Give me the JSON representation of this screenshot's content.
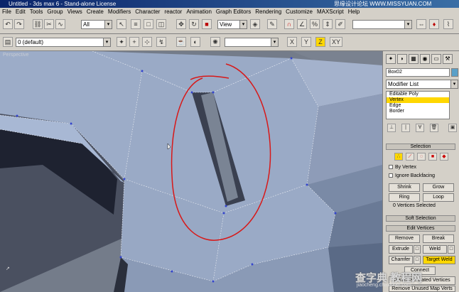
{
  "window": {
    "title": "Untitled - 3ds max 6 - Stand-alone License",
    "watermark_top": "思缘设计论坛  WWW.MISSYUAN.COM"
  },
  "menu": [
    "File",
    "Edit",
    "Tools",
    "Group",
    "Views",
    "Create",
    "Modifiers",
    "Character",
    "reactor",
    "Animation",
    "Graph Editors",
    "Rendering",
    "Customize",
    "MAXScript",
    "Help"
  ],
  "toolbar": {
    "selection_filter": "All",
    "reference_coord": "View",
    "named_selection": ""
  },
  "toolbar2": {
    "layer": "0 (default)",
    "axis_x": "X",
    "axis_y": "Y",
    "axis_z": "Z",
    "axis_xy": "XY"
  },
  "viewport": {
    "label": "Perspective"
  },
  "command_panel": {
    "object_name": "Box02",
    "modifier_list": "Modifier List",
    "stack": [
      "Editable Poly",
      "Vertex",
      "Edge",
      "Border"
    ],
    "stack_selected_index": 1,
    "selection_title": "Selection",
    "by_vertex": "By Vertex",
    "ignore_backfacing": "Ignore Backfacing",
    "shrink": "Shrink",
    "grow": "Grow",
    "ring": "Ring",
    "loop": "Loop",
    "vertices_selected": "0 Vertices Selected",
    "soft_selection": "Soft Selection",
    "edit_vertices": "Edit Vertices",
    "remove": "Remove",
    "break": "Break",
    "extrude": "Extrude",
    "weld": "Weld",
    "chamfer": "Chamfer",
    "target_weld": "Target Weld",
    "connect": "Connect",
    "remove_isolated": "Remove Isolated Vertices",
    "remove_unused": "Remove Unused Map Verts"
  },
  "watermark": {
    "main": "查字典 教程网",
    "url": "jiaocheng.chazidian.com"
  },
  "colors": {
    "title_bar": "#0a246a",
    "viewport_bg": "#7a8290",
    "mesh_face": "#9aa8c2",
    "highlight": "#ffd700",
    "annotation": "#d81818"
  }
}
